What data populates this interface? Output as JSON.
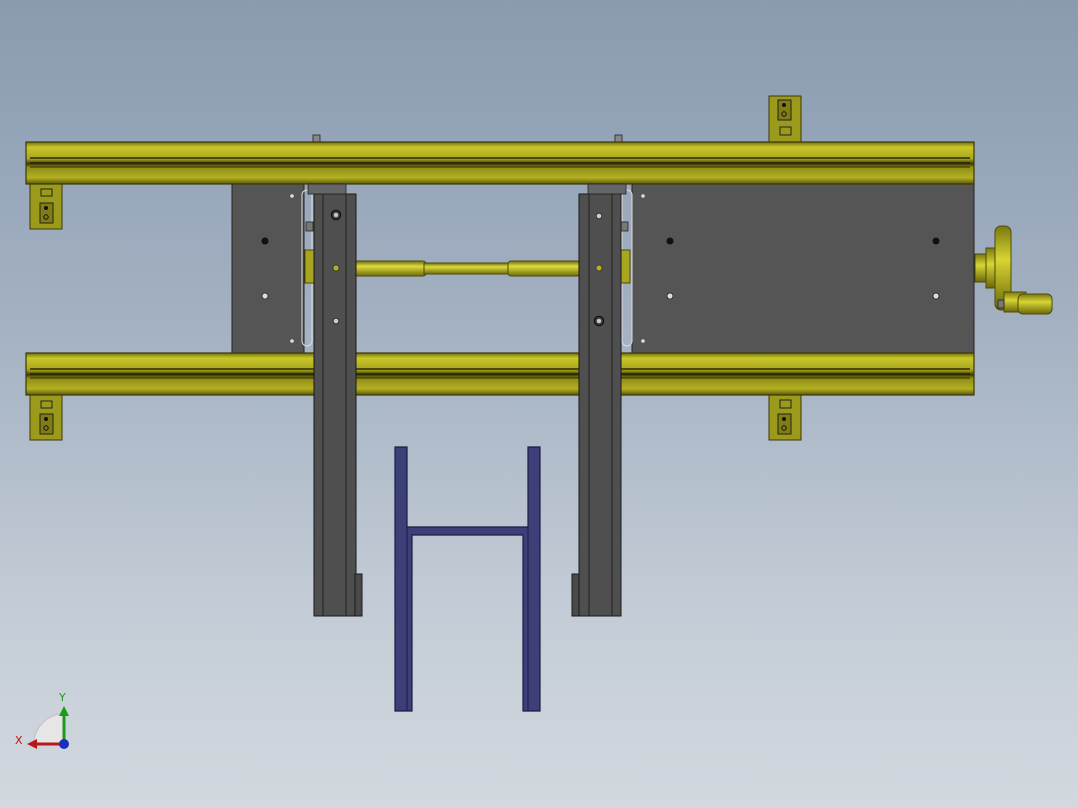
{
  "view": {
    "background": "CAD viewport",
    "colors": {
      "rail": "#9c9a1a",
      "rail_light": "#c9c62a",
      "rail_dark": "#4e4c08",
      "plate": "#555555",
      "plate_edge": "#222222",
      "frame": "#3c3f78",
      "frame_edge": "#1a1c44"
    }
  },
  "triad": {
    "x_label": "X",
    "y_label": "Y",
    "x_color": "#b81818",
    "y_color": "#1c9a1c",
    "z_color": "#1a2fbf"
  },
  "parts": {
    "top_rail": "aluminum-profile-rail",
    "bottom_rail": "aluminum-profile-rail",
    "left_plate": "mounting-plate",
    "right_plate": "mounting-plate",
    "shaft": "lead-screw",
    "hand_crank": "hand-wheel",
    "left_jaw": "clamp-jaw",
    "right_jaw": "clamp-jaw",
    "workpiece": "h-frame"
  }
}
